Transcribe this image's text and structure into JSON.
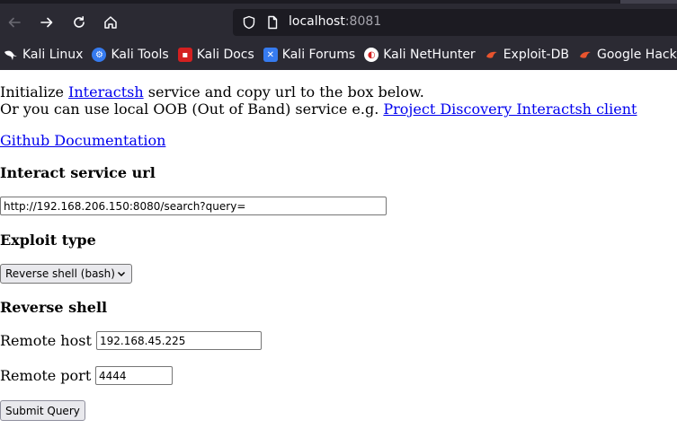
{
  "browser": {
    "url_host": "localhost",
    "url_port": ":8081",
    "bookmarks": [
      {
        "label": "Kali Linux",
        "icon": "kali-dragon-icon",
        "color": "#1c1b22"
      },
      {
        "label": "Kali Tools",
        "icon": "kali-tools-icon",
        "color": "#367bf0"
      },
      {
        "label": "Kali Docs",
        "icon": "kali-docs-icon",
        "color": "#d42020"
      },
      {
        "label": "Kali Forums",
        "icon": "kali-forums-icon",
        "color": "#367bf0"
      },
      {
        "label": "Kali NetHunter",
        "icon": "nethunter-icon",
        "color": "#d42020"
      },
      {
        "label": "Exploit-DB",
        "icon": "exploit-db-icon",
        "color": "#e8542e"
      },
      {
        "label": "Google Hacking",
        "icon": "ghdb-icon",
        "color": "#e8542e"
      }
    ]
  },
  "page": {
    "intro_prefix": "Initialize ",
    "intro_link": "Interactsh",
    "intro_suffix": " service and copy url to the box below.",
    "oob_prefix": "Or you can use local OOB (Out of Band) service e.g. ",
    "oob_link": "Project Discovery Interactsh client",
    "github_link": "Github Documentation",
    "interact_heading": "Interact service url",
    "interact_value": "http://192.168.206.150:8080/search?query=",
    "exploit_heading": "Exploit type",
    "exploit_selected": "Reverse shell (bash)",
    "reverse_heading": "Reverse shell",
    "remote_host_label": "Remote host",
    "remote_host_value": "192.168.45.225",
    "remote_port_label": "Remote port",
    "remote_port_value": "4444",
    "submit_label": "Submit Query"
  },
  "colors": {
    "chrome_bg": "#2b2a33",
    "urlbar_bg": "#1c1b22",
    "link": "#0000ee"
  }
}
